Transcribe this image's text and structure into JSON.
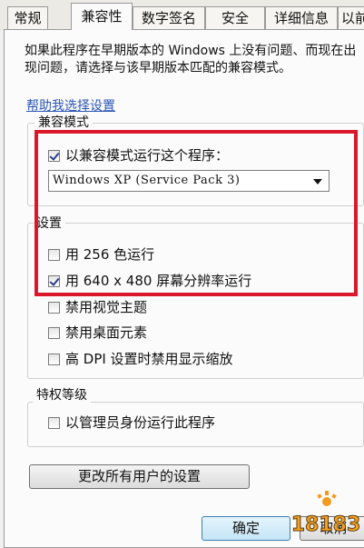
{
  "tabs": [
    {
      "label": "常规",
      "active": false
    },
    {
      "label": "兼容性",
      "active": true
    },
    {
      "label": "数字签名",
      "active": false
    },
    {
      "label": "安全",
      "active": false
    },
    {
      "label": "详细信息",
      "active": false
    },
    {
      "label": "以前",
      "active": false
    }
  ],
  "intro_text": "如果此程序在早期版本的 Windows 上没有问题、而现在出现问题，请选择与该早期版本匹配的兼容模式。",
  "help_link": "帮助我选择设置",
  "compat_mode": {
    "legend": "兼容模式",
    "checkbox_label": "以兼容模式运行这个程序：",
    "checked": true,
    "selected_os": "Windows XP (Service Pack 3)"
  },
  "settings": {
    "legend": "设置",
    "options": [
      {
        "label": "用 256 色运行",
        "checked": false
      },
      {
        "label": "用 640 x 480 屏幕分辨率运行",
        "checked": true
      },
      {
        "label": "禁用视觉主题",
        "checked": false
      },
      {
        "label": "禁用桌面元素",
        "checked": false
      },
      {
        "label": "高 DPI 设置时禁用显示缩放",
        "checked": false
      }
    ]
  },
  "privilege": {
    "legend": "特权等级",
    "checkbox_label": "以管理员身份运行此程序",
    "checked": false
  },
  "change_all_users_button": "更改所有用户的设置",
  "ok_button": "确定",
  "cancel_button": "取消",
  "watermark_text": "18183",
  "highlight_color": "#d9182b",
  "link_color": "#2a56b6"
}
